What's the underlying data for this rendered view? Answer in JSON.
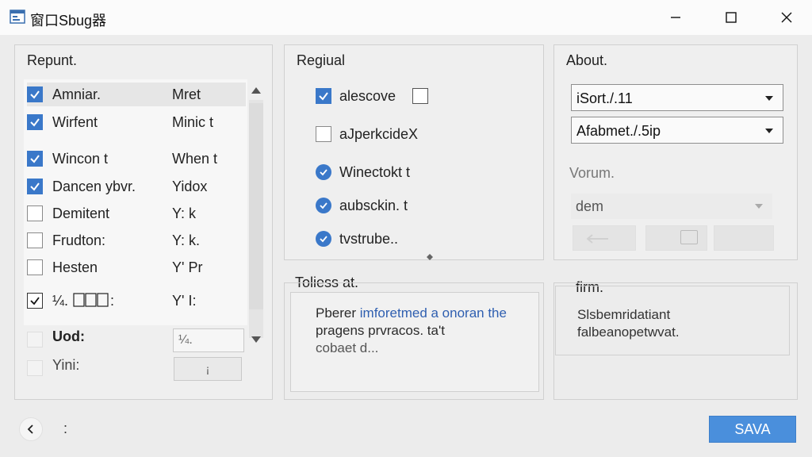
{
  "window": {
    "title": "窗口Sbug器"
  },
  "left_panel": {
    "title": "Repunt.",
    "rows": [
      {
        "name": "Amniar.",
        "value": "Mret",
        "state": "checked"
      },
      {
        "name": "Wirfent",
        "value": "Minic t",
        "state": "checked"
      },
      {
        "name": "Wincon t",
        "value": "When t",
        "state": "checked"
      },
      {
        "name": "Dancen ybvr.",
        "value": "Yidox",
        "state": "checked"
      },
      {
        "name": "Demitent",
        "value": "Y: k",
        "state": "unchecked"
      },
      {
        "name": "Frudton:",
        "value": "Y: k.",
        "state": "unchecked"
      },
      {
        "name": "Hesten",
        "value": "Y' Pr",
        "state": "unchecked"
      },
      {
        "name": "¼.",
        "value": "Y' I:",
        "state": "tick"
      }
    ],
    "uod_label": "Uod:",
    "uod_field": "¼.",
    "yini_label": "Yini:",
    "yini_button": "¡"
  },
  "middle_panel": {
    "title": "Regiual",
    "options": [
      {
        "label": "alescove",
        "kind": "checkbox",
        "checked": true
      },
      {
        "label": "aJperkcideX",
        "kind": "checkbox",
        "checked": false
      },
      {
        "label": "Winectokt t",
        "kind": "radio",
        "checked": true
      },
      {
        "label": "aubsckin. t",
        "kind": "radio",
        "checked": true
      },
      {
        "label": "tvstrube..",
        "kind": "radio",
        "checked": true
      }
    ]
  },
  "text_panel": {
    "title": "Toliess at.",
    "line1_a": "Pberer ",
    "line1_link": "imforetmed a onoran the",
    "line2": "pragens prvracos. ta't",
    "line3": "cobaet d..."
  },
  "right_panel": {
    "title": "About.",
    "select1": "iSort./.11",
    "select2": "Afabmet./.5ip",
    "volume_label": "Vorum.",
    "volume_select": "dem"
  },
  "firm_panel": {
    "title": "firm.",
    "line1": "Slsbemridatiant",
    "line2": "falbeanopetwvat."
  },
  "footer": {
    "save_label": "SAVA",
    "dots": ":"
  }
}
